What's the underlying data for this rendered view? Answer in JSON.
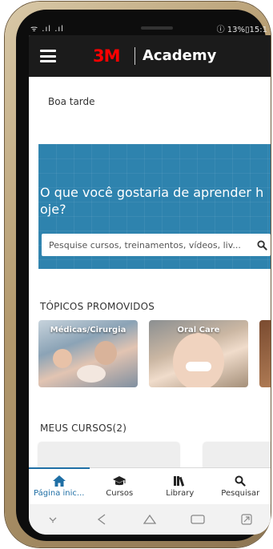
{
  "status_bar": {
    "left_icons": "ᯤ .ıl .ıl",
    "right_text": "ⓘ 13%▯15:1"
  },
  "header": {
    "menu_icon": "hamburger-menu-icon",
    "brand_logo": "3M",
    "app_name": "Academy",
    "background": "#1b1b1b"
  },
  "greeting": "Boa tarde",
  "hero": {
    "title": "O que você gostaria de aprender hoje?",
    "search_placeholder": "Pesquise cursos, treinamentos, vídeos, liv...",
    "search_icon": "search-icon",
    "background": "#2e83ae"
  },
  "sections": {
    "promoted_title": "TÓPICOS PROMOVIDOS",
    "my_courses_title": "MEUS CURSOS(2)"
  },
  "topics": [
    {
      "label": "Médicas/Cirurgia"
    },
    {
      "label": "Oral Care"
    },
    {
      "label": ""
    }
  ],
  "bottom_nav": {
    "items": [
      {
        "label": "Página inic...",
        "icon": "home-icon",
        "active": true
      },
      {
        "label": "Cursos",
        "icon": "graduation-cap-icon",
        "active": false
      },
      {
        "label": "Library",
        "icon": "library-icon",
        "active": false
      },
      {
        "label": "Pesquisar",
        "icon": "search-icon",
        "active": false
      }
    ],
    "accent": "#1f6fa5"
  },
  "system_nav": [
    "collapse-icon",
    "back-icon",
    "home-outline-icon",
    "recents-icon",
    "expand-icon"
  ]
}
